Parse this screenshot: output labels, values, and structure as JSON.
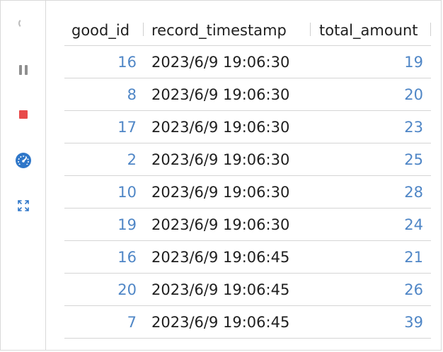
{
  "toolbar": {
    "icons": [
      "loading-spinner-icon",
      "pause-icon",
      "stop-icon",
      "gauge-icon",
      "expand-icon"
    ],
    "colors": {
      "stop": "#e84a4a",
      "gauge": "#2f77c9",
      "expand": "#2f77c9",
      "muted": "#8f8f8f"
    }
  },
  "table": {
    "columns": [
      "good_id",
      "record_timestamp",
      "total_amount"
    ],
    "rows": [
      {
        "good_id": "16",
        "record_timestamp": "2023/6/9 19:06:30",
        "total_amount": "19"
      },
      {
        "good_id": "8",
        "record_timestamp": "2023/6/9 19:06:30",
        "total_amount": "20"
      },
      {
        "good_id": "17",
        "record_timestamp": "2023/6/9 19:06:30",
        "total_amount": "23"
      },
      {
        "good_id": "2",
        "record_timestamp": "2023/6/9 19:06:30",
        "total_amount": "25"
      },
      {
        "good_id": "10",
        "record_timestamp": "2023/6/9 19:06:30",
        "total_amount": "28"
      },
      {
        "good_id": "19",
        "record_timestamp": "2023/6/9 19:06:30",
        "total_amount": "24"
      },
      {
        "good_id": "16",
        "record_timestamp": "2023/6/9 19:06:45",
        "total_amount": "21"
      },
      {
        "good_id": "20",
        "record_timestamp": "2023/6/9 19:06:45",
        "total_amount": "26"
      },
      {
        "good_id": "7",
        "record_timestamp": "2023/6/9 19:06:45",
        "total_amount": "39"
      }
    ],
    "colors": {
      "numeric": "#4f86c6",
      "text": "#1f1f1f",
      "border": "#d5d5d5"
    }
  }
}
